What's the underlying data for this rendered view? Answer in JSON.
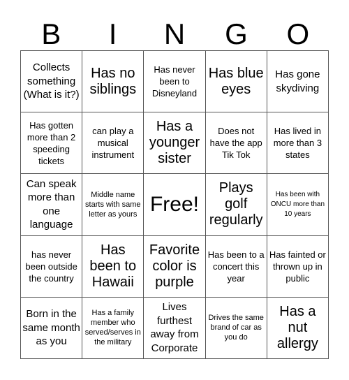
{
  "header": {
    "letters": [
      "B",
      "I",
      "N",
      "G",
      "O"
    ]
  },
  "cells": [
    {
      "text": "Collects something (What is it?)",
      "size": "m"
    },
    {
      "text": "Has no siblings",
      "size": "l"
    },
    {
      "text": "Has never been to Disneyland",
      "size": "s"
    },
    {
      "text": "Has blue eyes",
      "size": "l"
    },
    {
      "text": "Has gone skydiving",
      "size": "m"
    },
    {
      "text": "Has gotten more than 2 speeding tickets",
      "size": "s"
    },
    {
      "text": "can play a musical instrument",
      "size": "s"
    },
    {
      "text": "Has a younger sister",
      "size": "l"
    },
    {
      "text": "Does not have the app Tik Tok",
      "size": "s"
    },
    {
      "text": "Has lived in more than 3 states",
      "size": "s"
    },
    {
      "text": "Can speak more than one language",
      "size": "m"
    },
    {
      "text": "Middle name starts with same letter as yours",
      "size": "xs"
    },
    {
      "text": "Free!",
      "size": "xl"
    },
    {
      "text": "Plays golf regularly",
      "size": "l"
    },
    {
      "text": "Has been with ONCU more than 10 years",
      "size": "xxs"
    },
    {
      "text": "has never been outside the country",
      "size": "s"
    },
    {
      "text": "Has been to Hawaii",
      "size": "l"
    },
    {
      "text": "Favorite color is purple",
      "size": "l"
    },
    {
      "text": "Has been to a concert this year",
      "size": "s"
    },
    {
      "text": "Has fainted or thrown up in public",
      "size": "s"
    },
    {
      "text": "Born in the same month as you",
      "size": "m"
    },
    {
      "text": "Has a family member who served/serves in the military",
      "size": "xs"
    },
    {
      "text": "Lives furthest away from Corporate",
      "size": "m"
    },
    {
      "text": "Drives the same brand of car as you do",
      "size": "xs"
    },
    {
      "text": "Has a nut allergy",
      "size": "l"
    }
  ]
}
